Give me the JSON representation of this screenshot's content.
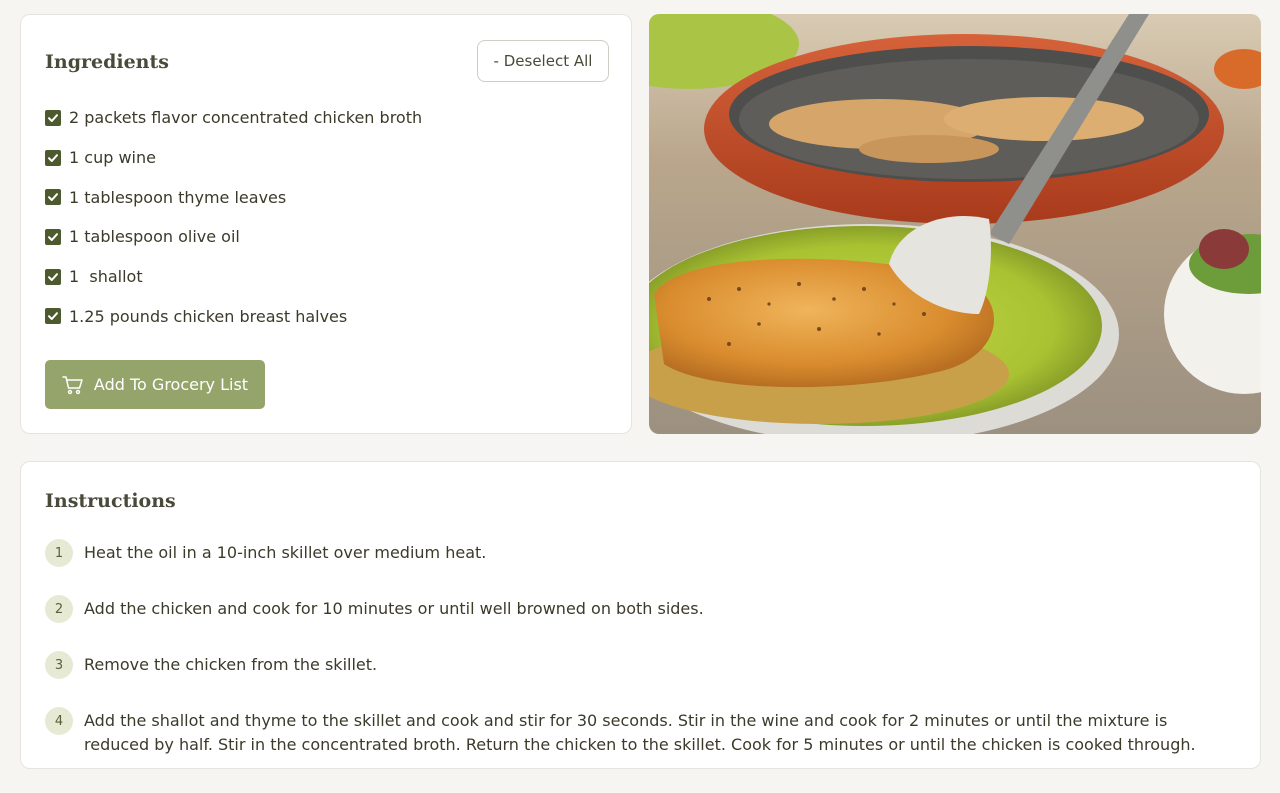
{
  "ingredients": {
    "title": "Ingredients",
    "deselect_label": "- Deselect All",
    "items": [
      {
        "label": "2 packets flavor concentrated chicken broth",
        "checked": true
      },
      {
        "label": "1 cup wine",
        "checked": true
      },
      {
        "label": "1 tablespoon thyme leaves",
        "checked": true
      },
      {
        "label": "1 tablespoon olive oil",
        "checked": true
      },
      {
        "label": "1  shallot",
        "checked": true
      },
      {
        "label": "1.25 pounds chicken breast halves",
        "checked": true
      }
    ],
    "grocery_button_label": "Add To Grocery List"
  },
  "photo": {
    "icon": "recipe-photo"
  },
  "instructions": {
    "title": "Instructions",
    "steps": [
      {
        "number": "1",
        "text": "Heat the oil in a 10-inch skillet over medium heat."
      },
      {
        "number": "2",
        "text": "Add the chicken and cook for 10 minutes or until well browned on both sides."
      },
      {
        "number": "3",
        "text": "Remove the chicken from the skillet."
      },
      {
        "number": "4",
        "text": "Add the shallot and thyme to the skillet and cook and stir for 30 seconds. Stir in the wine and cook for 2 minutes or until the mixture is reduced by half. Stir in the concentrated broth. Return the chicken to the skillet. Cook for 5 minutes or until the chicken is cooked through."
      }
    ]
  },
  "colors": {
    "accent": "#95a46b",
    "checkbox": "#4d5a2e",
    "step_badge": "#e6e9d4"
  }
}
